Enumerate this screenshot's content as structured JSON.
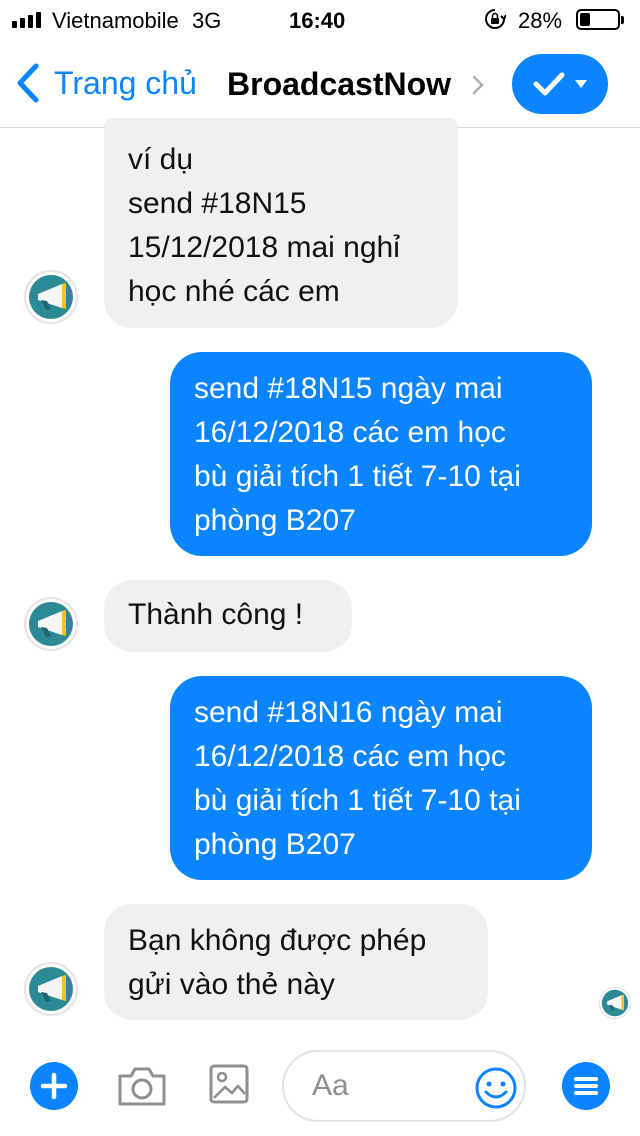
{
  "status_bar": {
    "carrier": "Vietnamobile",
    "network": "3G",
    "time": "16:40",
    "battery_percent": "28%",
    "battery_level": 0.28,
    "signal_bars": 4,
    "icons": [
      "signal-icon",
      "orientation-lock-icon",
      "battery-icon"
    ]
  },
  "nav": {
    "back_label": "Trang chủ",
    "title": "BroadcastNow",
    "icons": [
      "back-chevron-icon",
      "chevron-right-icon",
      "checkmark-icon",
      "caret-down-icon"
    ]
  },
  "colors": {
    "accent": "#0a84ff",
    "incoming_bubble": "#f0f0f0",
    "bot_avatar_teal": "#2c8a96",
    "bot_avatar_yellow": "#f5c518"
  },
  "messages": [
    {
      "sender": "bot",
      "lines": [
        "ví dụ",
        "send #18N15",
        "15/12/2018 mai nghỉ",
        "học nhé các em"
      ]
    },
    {
      "sender": "me",
      "lines": [
        "send #18N15 ngày mai",
        "16/12/2018 các em học",
        "bù giải tích 1 tiết 7-10 tại",
        "phòng B207"
      ]
    },
    {
      "sender": "bot",
      "lines": [
        "Thành công !"
      ]
    },
    {
      "sender": "me",
      "lines": [
        "send #18N16 ngày mai",
        "16/12/2018 các em học",
        "bù giải tích 1 tiết 7-10 tại",
        "phòng B207"
      ]
    },
    {
      "sender": "bot",
      "lines": [
        "Bạn không được phép",
        "gửi vào thẻ này"
      ]
    }
  ],
  "composer": {
    "placeholder": "Aa",
    "icons": [
      "plus-icon",
      "camera-icon",
      "gallery-icon",
      "emoji-icon",
      "menu-icon"
    ]
  }
}
